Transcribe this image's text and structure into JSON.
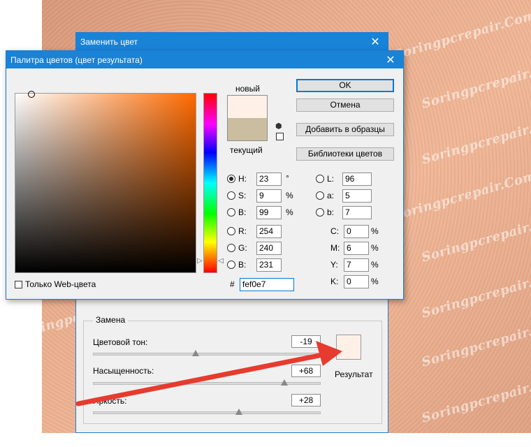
{
  "background": {
    "watermarks": [
      "Soringpcrepair.Com"
    ]
  },
  "replace_dialog": {
    "title": "Заменить цвет",
    "group_title": "Замена",
    "sliders": [
      {
        "label": "Цветовой тон:",
        "value": "-19",
        "level": 0.45
      },
      {
        "label": "Насыщенность:",
        "value": "+68",
        "level": 0.84
      },
      {
        "label": "Яркость:",
        "value": "+28",
        "level": 0.64
      }
    ],
    "result_label": "Результат",
    "result_color": "#fef0e7"
  },
  "color_picker": {
    "title": "Палитра цветов (цвет результата)",
    "new_label": "новый",
    "current_label": "текущий",
    "new_color": "#fef0e7",
    "current_color": "#cbbd9f",
    "buttons": {
      "ok": "OK",
      "cancel": "Отмена",
      "add_swatches": "Добавить в образцы",
      "libraries": "Библиотеки цветов"
    },
    "fields_left": [
      {
        "label": "H:",
        "value": "23",
        "unit": "°",
        "selected": true
      },
      {
        "label": "S:",
        "value": "9",
        "unit": "%"
      },
      {
        "label": "B:",
        "value": "99",
        "unit": "%"
      },
      {
        "label": "R:",
        "value": "254",
        "unit": ""
      },
      {
        "label": "G:",
        "value": "240",
        "unit": ""
      },
      {
        "label": "B:",
        "value": "231",
        "unit": ""
      }
    ],
    "fields_lab": [
      {
        "label": "L:",
        "value": "96"
      },
      {
        "label": "a:",
        "value": "5"
      },
      {
        "label": "b:",
        "value": "7"
      }
    ],
    "fields_cmyk": [
      {
        "label": "C:",
        "value": "0",
        "unit": "%"
      },
      {
        "label": "M:",
        "value": "6",
        "unit": "%"
      },
      {
        "label": "Y:",
        "value": "7",
        "unit": "%"
      },
      {
        "label": "K:",
        "value": "0",
        "unit": "%"
      }
    ],
    "hex_label": "#",
    "hex_value": "fef0e7",
    "web_only_label": "Только Web-цвета",
    "field_hue_color": "#ff6a00"
  },
  "accent_colors": {
    "titlebar": "#1883d7",
    "arrow": "#e63b2e"
  },
  "icons": {
    "close": "close-icon",
    "cube": "web-safe-cube-icon"
  }
}
